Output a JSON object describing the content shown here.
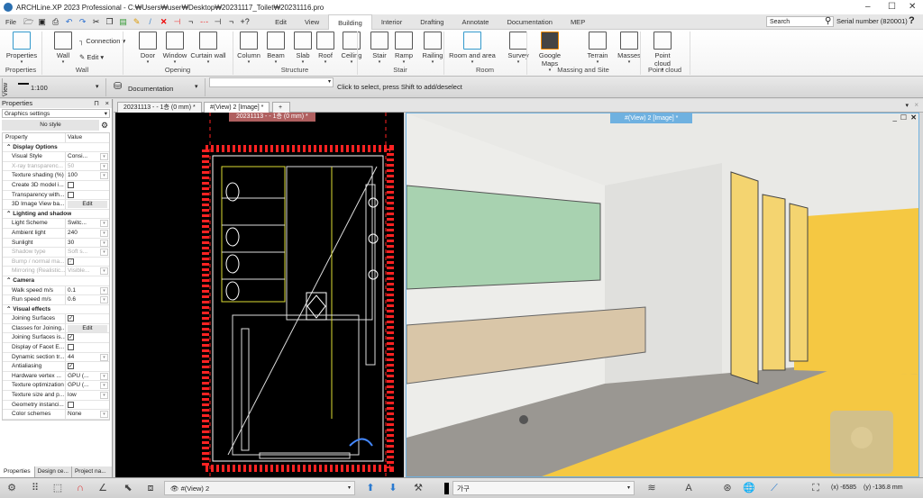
{
  "app": {
    "title": "ARCHLine.XP 2023 Professional - C:₩Users₩user₩Desktop₩20231117_Toilet₩20231116.pro"
  },
  "menu": {
    "file": "File",
    "tabs": [
      "Edit",
      "View",
      "Building",
      "Interior",
      "Drafting",
      "Annotate",
      "Documentation",
      "MEP"
    ],
    "active_tab": "Building",
    "search_placeholder": "Search",
    "serial": "Serial number (820001)",
    "help": "?"
  },
  "ribbon": {
    "buttons": [
      {
        "label": "Properties",
        "icon": "properties-icon"
      },
      {
        "label": "Wall",
        "icon": "wall-icon"
      },
      {
        "label": "Connection",
        "icon": "connection-icon"
      },
      {
        "label": "Edit",
        "icon": "edit-icon"
      },
      {
        "label": "Door",
        "icon": "door-icon"
      },
      {
        "label": "Window",
        "icon": "window-icon"
      },
      {
        "label": "Curtain wall",
        "icon": "curtain-wall-icon"
      },
      {
        "label": "Column",
        "icon": "column-icon"
      },
      {
        "label": "Beam",
        "icon": "beam-icon"
      },
      {
        "label": "Slab",
        "icon": "slab-icon"
      },
      {
        "label": "Roof",
        "icon": "roof-icon"
      },
      {
        "label": "Ceiling",
        "icon": "ceiling-icon"
      },
      {
        "label": "Stair",
        "icon": "stair-icon"
      },
      {
        "label": "Ramp",
        "icon": "ramp-icon"
      },
      {
        "label": "Railing",
        "icon": "railing-icon"
      },
      {
        "label": "Room and area",
        "icon": "room-icon"
      },
      {
        "label": "Survey",
        "icon": "survey-icon"
      },
      {
        "label": "Google Maps",
        "icon": "google-maps-icon"
      },
      {
        "label": "Terrain",
        "icon": "terrain-icon"
      },
      {
        "label": "Masses",
        "icon": "masses-icon"
      },
      {
        "label": "Point cloud",
        "icon": "point-cloud-icon"
      }
    ],
    "groups": [
      "Properties",
      "Wall",
      "Opening",
      "Structure",
      "Stair",
      "Room",
      "Massing and Site",
      "Point cloud"
    ]
  },
  "toolbar": {
    "view_label": "View",
    "scale": "1:100",
    "layer_set": "Documentation",
    "hint": "Click to select, press Shift to add/deselect"
  },
  "properties": {
    "title": "Properties",
    "dropdown": "Graphics settings",
    "style": "No style",
    "col_property": "Property",
    "col_value": "Value",
    "rows": [
      {
        "type": "sec",
        "k": "Display Options"
      },
      {
        "k": "Visual Style",
        "v": "Consi...",
        "dd": true
      },
      {
        "k": "X-ray transparenc...",
        "v": "50",
        "dd": true,
        "dim": true
      },
      {
        "k": "Texture shading (%)",
        "v": "100",
        "dd": true
      },
      {
        "k": "Create 3D model i...",
        "cb": ""
      },
      {
        "k": "Transparency with...",
        "cb": ""
      },
      {
        "k": "3D Image View ba...",
        "btn": "Edit"
      },
      {
        "type": "sec",
        "k": "Lighting and shadow"
      },
      {
        "k": "Light Scheme",
        "v": "Switc...",
        "dd": true
      },
      {
        "k": "Ambient light",
        "v": "240",
        "dd": true
      },
      {
        "k": "Sunlight",
        "v": "30",
        "dd": true
      },
      {
        "k": "Shadow type",
        "v": "Soft s...",
        "dd": true,
        "dim": true
      },
      {
        "k": "Bump / normal ma...",
        "cb": "✓",
        "dim": true
      },
      {
        "k": "Mirroring (Realistic...",
        "v": "Visible...",
        "dd": true,
        "dim": true
      },
      {
        "type": "sec",
        "k": "Camera"
      },
      {
        "k": "Walk speed m/s",
        "v": "0.1",
        "dd": true
      },
      {
        "k": "Run speed m/s",
        "v": "0.6",
        "dd": true
      },
      {
        "type": "sec",
        "k": "Visual effects"
      },
      {
        "k": "Joining Surfaces",
        "cb": "✓"
      },
      {
        "k": "Classes for Joining...",
        "btn": "Edit"
      },
      {
        "k": "Joining Surfaces is...",
        "cb": "✓"
      },
      {
        "k": "Display of Facet E...",
        "cb": ""
      },
      {
        "k": "Dynamic section tr...",
        "v": "44",
        "dd": true
      },
      {
        "k": "Antialiasing",
        "cb": "✓"
      },
      {
        "k": "Hardware vertex ...",
        "v": "GPU (...",
        "dd": true
      },
      {
        "k": "Texture optimization",
        "v": "GPU (...",
        "dd": true
      },
      {
        "k": "Texture size and p...",
        "v": "low",
        "dd": true
      },
      {
        "k": "Geometry instanci...",
        "cb": ""
      },
      {
        "k": "Color schemes",
        "v": "None",
        "dd": true
      }
    ],
    "bottom_tabs": [
      "Properties",
      "Design ce...",
      "Project na..."
    ]
  },
  "documents": {
    "tabs": [
      "20231113 - - 1층 (0 mm) *",
      "#(View) 2 [Image] *",
      "+"
    ],
    "plan_caption": "20231113 - - 1층 (0 mm) *",
    "render_caption": "#(View) 2 [Image] *"
  },
  "statusbar": {
    "view_select": "#(View) 2",
    "layer": "가구",
    "coords_x": "(x) -6585",
    "coords_y": "(y) -136.8 mm"
  },
  "colors": {
    "accent": "#6fb1e0",
    "plan_bg": "#000000",
    "plan_wall": "#ff2020",
    "plan_line": "#e0e040",
    "floor_yellow": "#f5c842"
  }
}
